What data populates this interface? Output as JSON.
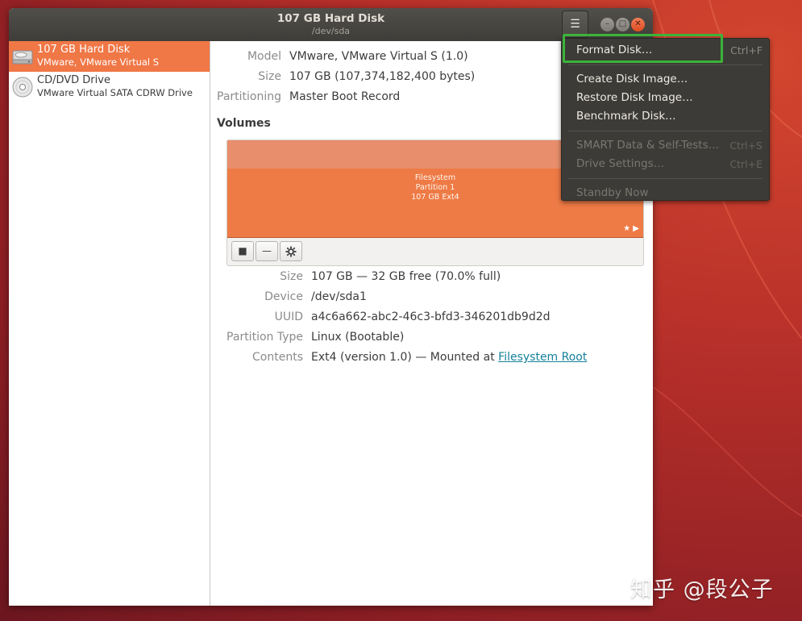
{
  "window": {
    "title": "107 GB Hard Disk",
    "subtitle": "/dev/sda",
    "menu_icon": "hamburger-menu-icon"
  },
  "sidebar": {
    "items": [
      {
        "name": "107 GB Hard Disk",
        "model": "VMware, VMware Virtual S",
        "icon": "hard-disk-icon",
        "selected": true
      },
      {
        "name": "CD/DVD Drive",
        "model": "VMware Virtual SATA CDRW Drive",
        "icon": "optical-disc-icon",
        "selected": false
      }
    ]
  },
  "disk_info": {
    "model_label": "Model",
    "model_value": "VMware, VMware Virtual S (1.0)",
    "size_label": "Size",
    "size_value": "107 GB (107,374,182,400 bytes)",
    "partitioning_label": "Partitioning",
    "partitioning_value": "Master Boot Record"
  },
  "volumes": {
    "heading": "Volumes",
    "partition": {
      "line1": "Filesystem",
      "line2": "Partition 1",
      "line3": "107 GB Ext4"
    },
    "tools": {
      "stop": "■",
      "remove": "—",
      "settings": "gear-icon"
    }
  },
  "volume_info": {
    "size_label": "Size",
    "size_value": "107 GB — 32 GB free (70.0% full)",
    "device_label": "Device",
    "device_value": "/dev/sda1",
    "uuid_label": "UUID",
    "uuid_value": "a4c6a662-abc2-46c3-bfd3-346201db9d2d",
    "ptype_label": "Partition Type",
    "ptype_value": "Linux (Bootable)",
    "contents_label": "Contents",
    "contents_prefix": "Ext4 (version 1.0) — Mounted at ",
    "contents_link": "Filesystem Root"
  },
  "menu": {
    "format": {
      "label": "Format Disk…",
      "shortcut": "Ctrl+F"
    },
    "create_image": {
      "label": "Create Disk Image…"
    },
    "restore_image": {
      "label": "Restore Disk Image…"
    },
    "benchmark": {
      "label": "Benchmark Disk…"
    },
    "smart": {
      "label": "SMART Data & Self-Tests…",
      "shortcut": "Ctrl+S"
    },
    "drive_settings": {
      "label": "Drive Settings…",
      "shortcut": "Ctrl+E"
    },
    "standby": {
      "label": "Standby Now"
    }
  },
  "watermark": "知乎 @段公子",
  "colors": {
    "accent": "#f07746",
    "partition": "#ee7a45",
    "highlight": "#3bb33a",
    "link": "#15819a"
  }
}
